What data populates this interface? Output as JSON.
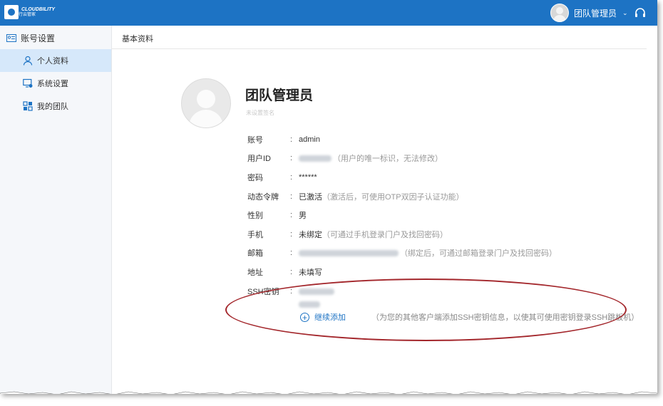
{
  "app": {
    "logo_text": "CLOUDBILITY",
    "logo_sub": "行云管家"
  },
  "header": {
    "user_name": "团队管理员",
    "chevron": "⌄"
  },
  "sidebar": {
    "group_label": "账号设置",
    "items": [
      {
        "label": "个人资料",
        "icon": "person-icon",
        "active": true
      },
      {
        "label": "系统设置",
        "icon": "monitor-gear-icon",
        "active": false
      },
      {
        "label": "我的团队",
        "icon": "grid-icon",
        "active": false
      }
    ]
  },
  "breadcrumb": "基本资料",
  "profile": {
    "name": "团队管理员",
    "signature": "未设置签名",
    "fields": [
      {
        "key": "账号",
        "value": "admin",
        "note": ""
      },
      {
        "key": "用户ID",
        "value": "",
        "note": "（用户的唯一标识，无法修改）"
      },
      {
        "key": "密码",
        "value": "******",
        "note": ""
      },
      {
        "key": "动态令牌",
        "value": "已激活",
        "note": "（激活后，可使用OTP双因子认证功能）"
      },
      {
        "key": "性别",
        "value": "男",
        "note": ""
      },
      {
        "key": "手机",
        "value": "未绑定",
        "note": "（可通过手机登录门户及找回密码）"
      },
      {
        "key": "邮箱",
        "value": "",
        "note": "（绑定后，可通过邮箱登录门户及找回密码）"
      },
      {
        "key": "地址",
        "value": "未填写",
        "note": ""
      },
      {
        "key": "SSH密钥",
        "value": "",
        "note": ""
      }
    ],
    "colon": ":",
    "ssh_add_label": "继续添加",
    "ssh_add_note": "（为您的其他客户端添加SSH密钥信息，以使其可使用密钥登录SSH跳板机）"
  },
  "colors": {
    "topbar": "#1d73c4",
    "active_item": "#d6e8fa",
    "highlight_ellipse": "#a3262b"
  }
}
